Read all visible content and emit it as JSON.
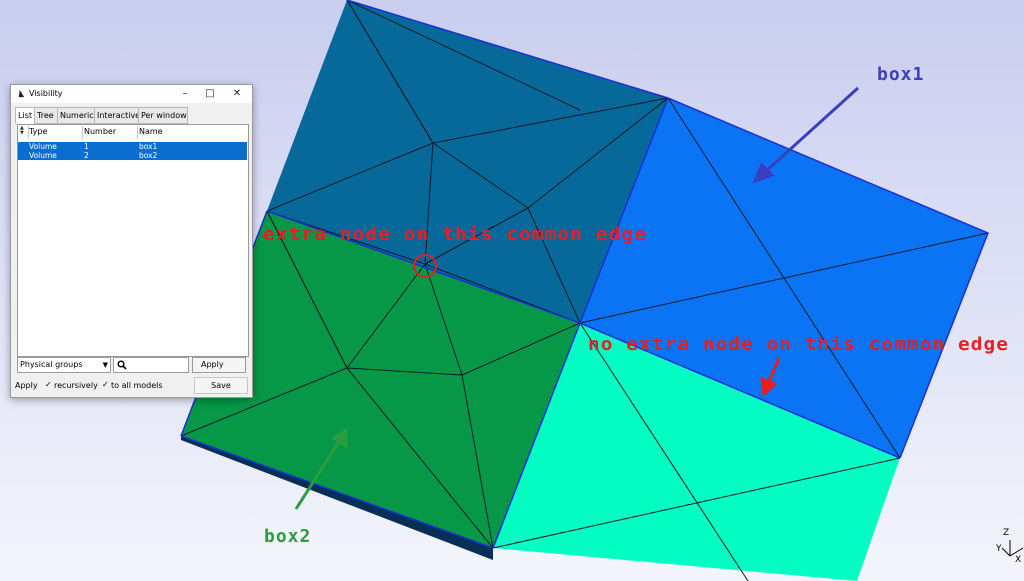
{
  "colors": {
    "background_top": "#c9ceef",
    "background_bottom": "#f4f5fc",
    "box1_top_face": "#07699a",
    "box1_front_face": "#0a74f5",
    "box2_top_face": "#069846",
    "box2_front_face": "#03fdc3",
    "annotation_red": "#e81e25",
    "annotation_blue": "#3b3fbf",
    "annotation_green": "#2a9d3f"
  },
  "annotations": {
    "box1": "box1",
    "box2": "box2",
    "extra_node": "extra node on this common edge",
    "no_extra_node": "no extra node on this common edge"
  },
  "window": {
    "title": "Visibility",
    "icon": "gmsh-logo-icon",
    "tabs": [
      "List",
      "Tree",
      "Numeric",
      "Interactive",
      "Per window"
    ],
    "columns": [
      "Type",
      "Number",
      "Name"
    ],
    "rows": [
      {
        "type": "Volume",
        "number": "1",
        "name": "box1"
      },
      {
        "type": "Volume",
        "number": "2",
        "name": "box2"
      }
    ],
    "filter_select": "Physical groups",
    "search_value": "",
    "apply_label": "Apply",
    "bottom_apply_label": "Apply",
    "recursively_label": "recursively",
    "all_models_label": "to all models",
    "save_label": "Save"
  },
  "axes": {
    "x": "X",
    "y": "Y",
    "z": "Z"
  }
}
